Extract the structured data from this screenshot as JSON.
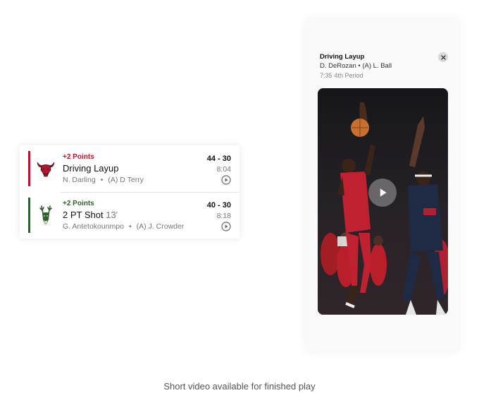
{
  "plays": [
    {
      "team": "bulls",
      "team_color": "#b3162e",
      "points": "+2 Points",
      "description": "Driving Layup",
      "distance": "",
      "player": "N. Darling",
      "assist": "(A) D Terry",
      "score": "44 - 30",
      "time": "8:04",
      "logo_icon": "bull-icon",
      "action_icon": "play-circle-icon"
    },
    {
      "team": "bucks",
      "team_color": "#2f5e2f",
      "points": "+2 Points",
      "description": "2 PT Shot",
      "distance": "13'",
      "player": "G. Antetokounmpo",
      "assist": "(A) J. Crowder",
      "score": "40 - 30",
      "time": "8:18",
      "logo_icon": "deer-icon",
      "action_icon": "play-circle-icon"
    }
  ],
  "modal": {
    "title": "Driving Layup",
    "players": "D. DeRozan • (A) L. Ball",
    "clock": "7:35",
    "period": "4th Period",
    "close_icon": "close-icon",
    "play_icon": "play-icon"
  },
  "caption": "Short video available for finished play",
  "colors": {
    "bulls_red": "#b3162e",
    "bucks_green": "#2f5e2f",
    "muted_text": "#777777"
  }
}
